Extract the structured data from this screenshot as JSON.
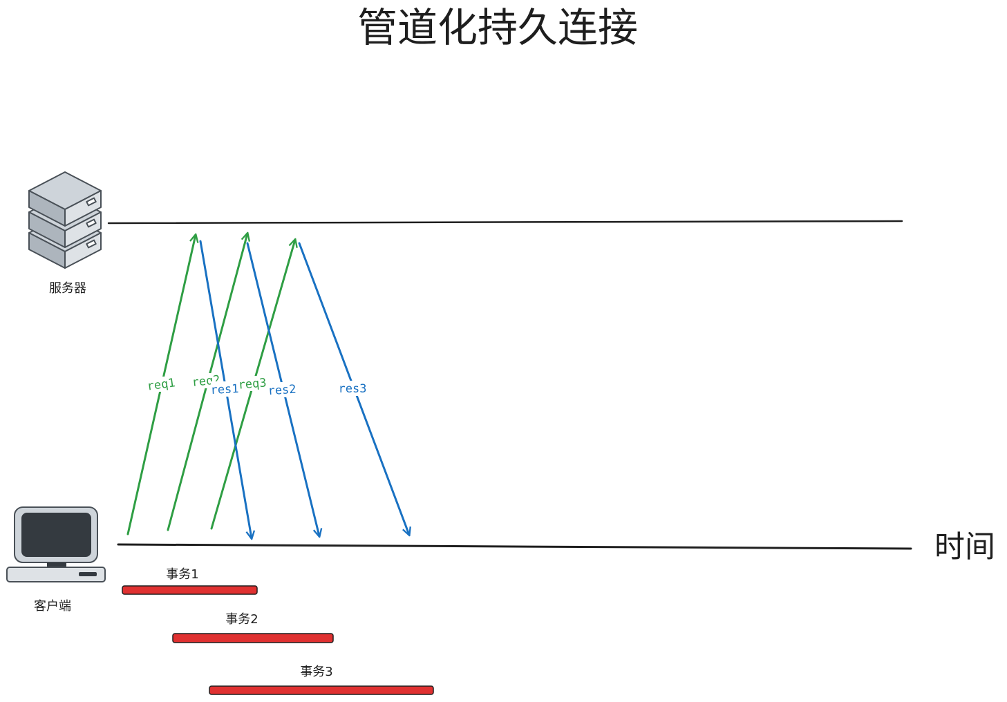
{
  "title": "管道化持久连接",
  "server": {
    "label": "服务器",
    "icon": "server-stack-icon"
  },
  "client": {
    "label": "客户端",
    "icon": "desktop-computer-icon"
  },
  "timeline_label": "时间",
  "colors": {
    "request": "#2f9e44",
    "response": "#1971c2",
    "transaction": "#e03131",
    "line": "#1e1e1e"
  },
  "requests": [
    {
      "label": "req1"
    },
    {
      "label": "req2"
    },
    {
      "label": "req3"
    }
  ],
  "responses": [
    {
      "label": "res1"
    },
    {
      "label": "res2"
    },
    {
      "label": "res3"
    }
  ],
  "transactions": [
    {
      "label": "事务1"
    },
    {
      "label": "事务2"
    },
    {
      "label": "事务3"
    }
  ]
}
